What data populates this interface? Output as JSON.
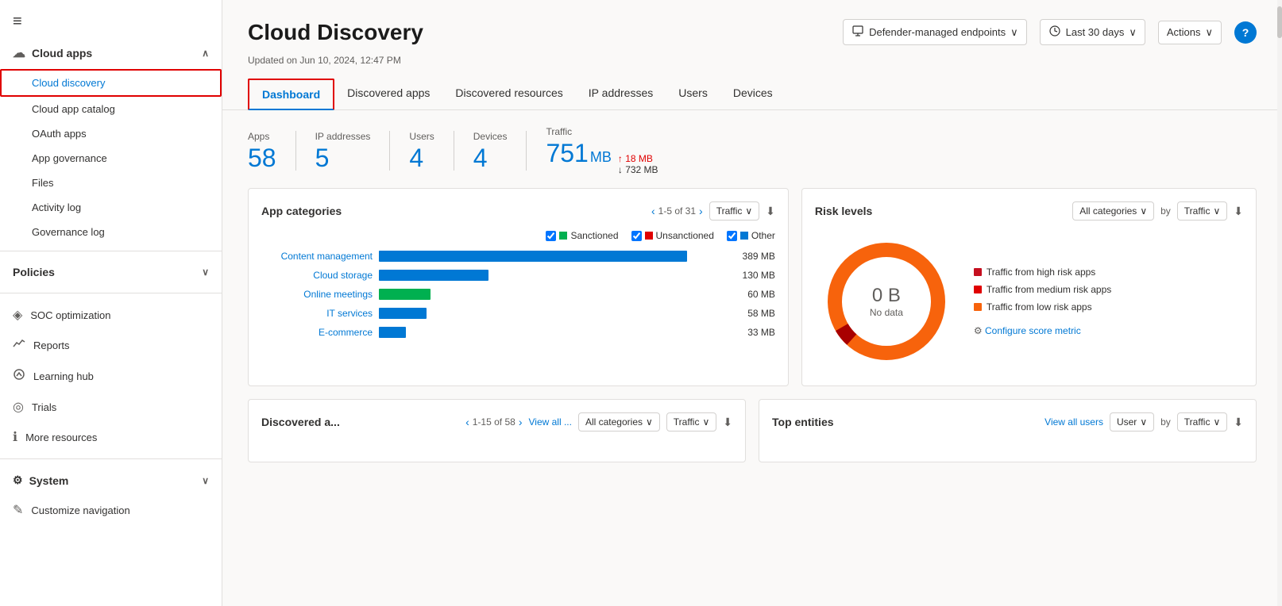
{
  "sidebar": {
    "hamburger_icon": "≡",
    "cloud_apps_label": "Cloud apps",
    "cloud_apps_chevron": "∧",
    "items": [
      {
        "label": "Cloud discovery",
        "active": true
      },
      {
        "label": "Cloud app catalog",
        "active": false
      },
      {
        "label": "OAuth apps",
        "active": false
      },
      {
        "label": "App governance",
        "active": false
      },
      {
        "label": "Files",
        "active": false
      },
      {
        "label": "Activity log",
        "active": false
      },
      {
        "label": "Governance log",
        "active": false
      }
    ],
    "policies_label": "Policies",
    "policies_chevron": "∨",
    "nav_items": [
      {
        "label": "SOC optimization",
        "icon": "◈"
      },
      {
        "label": "Reports",
        "icon": "📈"
      },
      {
        "label": "Learning hub",
        "icon": "🎓"
      },
      {
        "label": "Trials",
        "icon": "◎"
      },
      {
        "label": "More resources",
        "icon": "ℹ"
      }
    ],
    "system_label": "System",
    "system_chevron": "∨",
    "customize_label": "Customize navigation"
  },
  "header": {
    "title": "Cloud Discovery",
    "endpoint_btn": "Defender-managed endpoints",
    "time_btn": "Last 30 days",
    "actions_btn": "Actions",
    "help_btn": "?"
  },
  "updated_text": "Updated on Jun 10, 2024, 12:47 PM",
  "tabs": [
    {
      "label": "Dashboard",
      "active": true
    },
    {
      "label": "Discovered apps",
      "active": false
    },
    {
      "label": "Discovered resources",
      "active": false
    },
    {
      "label": "IP addresses",
      "active": false
    },
    {
      "label": "Users",
      "active": false
    },
    {
      "label": "Devices",
      "active": false
    }
  ],
  "stats": {
    "apps": {
      "label": "Apps",
      "value": "58"
    },
    "ip_addresses": {
      "label": "IP addresses",
      "value": "5"
    },
    "users": {
      "label": "Users",
      "value": "4"
    },
    "devices": {
      "label": "Devices",
      "value": "4"
    },
    "traffic": {
      "label": "Traffic",
      "value": "751",
      "unit": "MB",
      "upload": "18 MB",
      "download": "732 MB"
    }
  },
  "app_categories": {
    "title": "App categories",
    "pagination": "1-5 of 31",
    "filter": "Traffic",
    "legend": [
      {
        "label": "Sanctioned",
        "color": "#00b050"
      },
      {
        "label": "Unsanctioned",
        "color": "#e00000"
      },
      {
        "label": "Other",
        "color": "#0078d4"
      }
    ],
    "bars": [
      {
        "label": "Content management",
        "value": "389 MB",
        "width": 90,
        "color": "#0078d4"
      },
      {
        "label": "Cloud storage",
        "value": "130 MB",
        "width": 32,
        "color": "#0078d4"
      },
      {
        "label": "Online meetings",
        "value": "60 MB",
        "width": 15,
        "color": "#00b050"
      },
      {
        "label": "IT services",
        "value": "58 MB",
        "width": 14,
        "color": "#0078d4"
      },
      {
        "label": "E-commerce",
        "value": "33 MB",
        "width": 8,
        "color": "#0078d4"
      }
    ]
  },
  "risk_levels": {
    "title": "Risk levels",
    "category_filter": "All categories",
    "by_filter": "Traffic",
    "donut": {
      "value": "0 B",
      "label": "No data"
    },
    "legend": [
      {
        "label": "Traffic from high risk apps",
        "color": "#c50f1f"
      },
      {
        "label": "Traffic from medium risk apps",
        "color": "#e00000"
      },
      {
        "label": "Traffic from low risk apps",
        "color": "#f7630c"
      }
    ],
    "configure_label": "Configure score metric"
  },
  "discovered_apps": {
    "title": "Discovered a...",
    "pagination": "1-15 of 58",
    "view_all": "View all ...",
    "category_filter": "All categories",
    "by_filter": "Traffic"
  },
  "top_entities": {
    "title": "Top entities",
    "view_all": "View all users",
    "entity_filter": "User",
    "by_filter": "Traffic"
  }
}
